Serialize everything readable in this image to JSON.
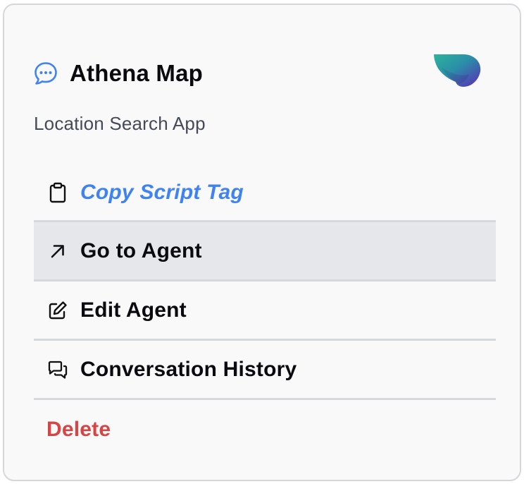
{
  "agent": {
    "title": "Athena Map",
    "subtitle": "Location Search App"
  },
  "menu": {
    "items": [
      {
        "label": "Copy Script Tag",
        "icon": "clipboard-icon"
      },
      {
        "label": "Go to Agent",
        "icon": "arrow-up-right-icon"
      },
      {
        "label": "Edit Agent",
        "icon": "edit-icon"
      },
      {
        "label": "Conversation History",
        "icon": "chat-bubbles-icon"
      },
      {
        "label": "Delete"
      }
    ]
  },
  "colors": {
    "accent": "#3f82f2",
    "danger": "#d64545",
    "hover_background": "#e6e7eb",
    "divider": "#d7d8dc",
    "card_background": "#f9f9fa"
  }
}
